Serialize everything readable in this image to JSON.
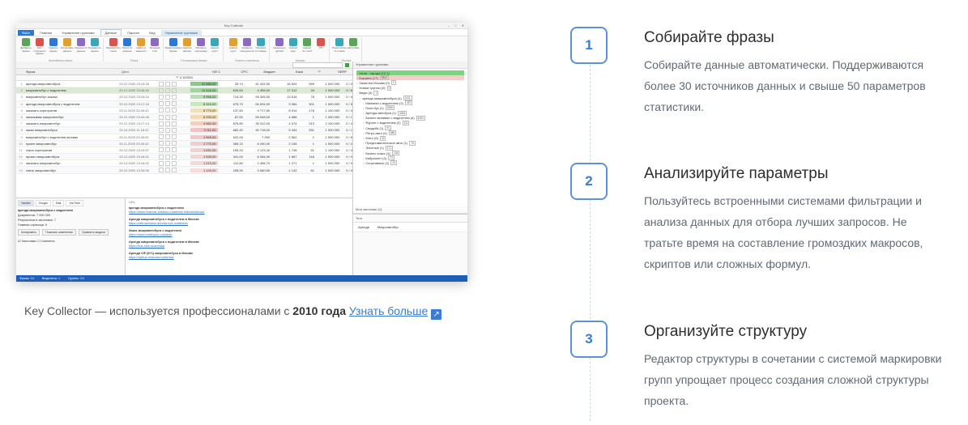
{
  "app": {
    "title": "Key Collector",
    "window_controls": [
      "–",
      "□",
      "✕"
    ],
    "ribbon_tabs": [
      "Файл",
      "Главная",
      "Управление группами",
      "Данные",
      "Парсинг",
      "Вид",
      "Управление группами"
    ],
    "ribbon_groups": [
      {
        "label": "Контейнеры фраз",
        "buttons": [
          "Добавить фразы",
          "Кол-попроекты фразы",
          "Удалить фразы",
          "Копировать данные",
          "Перенести данные",
          "Подсветить фразы"
        ]
      },
      {
        "label": "Поиск",
        "buttons": [
          "Переместить поиск",
          "Поиск по данным",
          "Найти и заменить",
          "Мощный стоп"
        ]
      },
      {
        "label": "Группировка фразы",
        "buttons": [
          "Редактировать фразы",
          "Удалить фильтр",
          "Обновить сортировку",
          "Анализ групп"
        ]
      },
      {
        "label": "Группы и фильтры",
        "buttons": [
          "Анализ групп",
          "Сравнить конкурентов",
          "Показать в словаре"
        ]
      },
      {
        "label": "Анализ",
        "buttons": [
          "Начальное дублей",
          "Анализ карт",
          "Анализ по столб",
          "КП"
        ]
      },
      {
        "label": "Прочее",
        "buttons": [
          "Пересчитать по ставке",
          "Настройки"
        ]
      }
    ],
    "grid": {
      "headers": [
        "Фраза",
        "Дата",
        "KEI 1",
        "CPC",
        "Бюджет",
        "База",
        "\"!\"",
        "SERP"
      ],
      "filter_hint": "\"!\" ≥ 110311",
      "rows": [
        {
          "n": "1",
          "phrase": "аренда микроавтобуса",
          "date": "20.12.2020 19:19:18",
          "ws": "11 580,00",
          "cpc": "33,74",
          "b1": "41 434,90",
          "b2": "18 524",
          "b3": "959",
          "b4": "1 000 000",
          "b5": "0 / 0"
        },
        {
          "n": "2",
          "phrase": "микроавтобус с водителем",
          "date": "20.12.2020 23:46:42",
          "ws": "11 416,00",
          "cpc": "629,60",
          "b1": "4 456,00",
          "b2": "17 312",
          "b3": "34",
          "b4": "1 000 000",
          "b5": "0 / 8"
        },
        {
          "n": "3",
          "phrase": "микроавтобус заказа",
          "date": "20.12.2020 23:15:10",
          "ws": "9 956,00",
          "cpc": "714,30",
          "b1": "93 305,00",
          "b2": "13 516",
          "b3": "75",
          "b4": "1 000 000",
          "b5": "0 / 0"
        },
        {
          "n": "4",
          "phrase": "аренда микроавтобуса с водителем",
          "date": "20.12.2020 13:17:15",
          "ws": "8 919,00",
          "cpc": "675,70",
          "b1": "54 534,90",
          "b2": "9 084",
          "b3": "301",
          "b4": "1 000 000",
          "b5": "0 / 5"
        },
        {
          "n": "5",
          "phrase": "заказать корпоратив",
          "date": "20.11.2020 23:40:42",
          "ws": "8 770,00",
          "cpc": "137,60",
          "b1": "9 717,80",
          "b2": "8 914",
          "b3": "178",
          "b4": "1 100 000",
          "b5": "0 / 0"
        },
        {
          "n": "6",
          "phrase": "заказываю микроавтобус",
          "date": "20.12.2020 23:44:45",
          "ws": "6 290,00",
          "cpc": "87,60",
          "b1": "59 548,00",
          "b2": "4 688",
          "b3": "1",
          "b4": "1 000 000",
          "b5": "0 / 1"
        },
        {
          "n": "7",
          "phrase": "заказать микроавтобус",
          "date": "20.12.2020 13:17:13",
          "ws": "4 962,00",
          "cpc": "875,80",
          "b1": "35 312,00",
          "b2": "4 374",
          "b3": "313",
          "b4": "2 100 000",
          "b5": "0 / 4"
        },
        {
          "n": "8",
          "phrase": "заказ микроавтобуса",
          "date": "20.10.2020 11:16:22",
          "ws": "3 111,00",
          "cpc": "682,40",
          "b1": "45 718,00",
          "b2": "5 344",
          "b3": "351",
          "b4": "1 000 000",
          "b5": "0 / 1"
        },
        {
          "n": "9",
          "phrase": "микроавтобус с водителем москва",
          "date": "20.11.2020 23:40:02",
          "ws": "1 909,00",
          "cpc": "622,00",
          "b1": "7 092",
          "b2": "2 562",
          "b3": "1",
          "b4": "1 000 000",
          "b5": "0 / 6"
        },
        {
          "n": "10",
          "phrase": "нужен микроавтобус",
          "date": "20.11.2020 23:40:42",
          "ws": "1 770,00",
          "cpc": "305,10",
          "b1": "6 290,00",
          "b2": "2 106",
          "b3": "1",
          "b4": "1 000 000",
          "b5": "0 / 2"
        },
        {
          "n": "11",
          "phrase": "такси корпоратив",
          "date": "20.12.2020 13:19:57",
          "ws": "1 691,00",
          "cpc": "195,20",
          "b1": "2 123,40",
          "b2": "1 745",
          "b3": "51",
          "b4": "1 100 000",
          "b5": "0 / 4"
        },
        {
          "n": "12",
          "phrase": "прокат микроавтобуса",
          "date": "20.12.2020 19:18:01",
          "ws": "1 545,00",
          "cpc": "341,00",
          "b1": "6 284,00",
          "b2": "1 667",
          "b3": "118",
          "b4": "1 000 000",
          "b5": "0 / 0"
        },
        {
          "n": "13",
          "phrase": "заказать микроавтобус",
          "date": "20.12.2020 13:16:22",
          "ws": "1 210,00",
          "cpc": "112,80",
          "b1": "2 456,70",
          "b2": "1 271",
          "b3": "1",
          "b4": "1 000 000",
          "b5": "0 / 0"
        },
        {
          "n": "14",
          "phrase": "снять микроавтобус",
          "date": "20.10.2020 13:16:00",
          "ws": "1 109,00",
          "cpc": "208,90",
          "b1": "3 060,90",
          "b2": "1 142",
          "b3": "61",
          "b4": "1 000 000",
          "b5": "0 / 0"
        }
      ]
    },
    "serp_panel": {
      "tabs": [
        "Yandex",
        "Google",
        "Mail",
        "YouTube"
      ],
      "query": "аренда микроавтобуса с водителем",
      "lines": [
        "Документов: 7 000 000",
        "Результатов в заголовке: 7",
        "Главная страница: 5"
      ],
      "buttons": [
        "Копировать",
        "Показать изменения",
        "Сравнить выдачи"
      ],
      "checkboxes": [
        "Заголовки",
        "Сниппеты"
      ]
    },
    "url_panel": {
      "header": "URL",
      "results": [
        {
          "title": "аренда микроавтобуса с водителем",
          "link": "https://www.moscow-autobus.ru/arenda-mikroavtobusa/"
        },
        {
          "title": "Аренда микроавтобуса с водителем в Москве",
          "link": "https://mikroavtobus-arenda.ru/s-voditelem/"
        },
        {
          "title": "Заказ микроавтобуса с водителем",
          "link": "https://www.busforyou.ru/zakaz/"
        },
        {
          "title": "Аренда микроавтобуса с водителем в Москве",
          "link": "https://bus-msk.ru/arenda/"
        },
        {
          "title": "Аренда VIP (8+1) микроавтобуса в Москве",
          "link": "https://vipbus-moscow.ru/arenda/"
        }
      ]
    },
    "groups_panel": {
      "header": "Управление группами",
      "items": [
        {
          "label": "Нали - города (10 1)",
          "tag": "",
          "style": "green"
        },
        {
          "label": "Корзина (17)",
          "tag": "9512",
          "style": "pink"
        },
        {
          "label": "Зачистка Москва (0)",
          "tag": "0",
          "style": ""
        },
        {
          "label": "Новые группы (0)",
          "tag": "0",
          "style": ""
        },
        {
          "label": "Виды (4)",
          "tag": "1",
          "style": ""
        },
        {
          "label": "аренда микроавтобуса (4)",
          "tag": "1411",
          "style": ""
        },
        {
          "label": "Минивэн с водителем (2)",
          "tag": "457",
          "style": ""
        },
        {
          "label": "Пати бус (1)",
          "tag": "2066",
          "style": ""
        },
        {
          "label": "Аренда автобуса (1)",
          "tag": "4453",
          "style": ""
        },
        {
          "label": "Бизнес минивэн с водителем (4)",
          "tag": "4053",
          "style": ""
        },
        {
          "label": "Фургон с водителем (2)",
          "tag": "111",
          "style": ""
        },
        {
          "label": "Свадьба (1)",
          "tag": "91",
          "style": ""
        },
        {
          "label": "Ретро-авто (4)",
          "tag": "686",
          "style": ""
        },
        {
          "label": "Мото (6)",
          "tag": "32",
          "style": ""
        },
        {
          "label": "Представительское авто (1)",
          "tag": "76",
          "style": ""
        },
        {
          "label": "Элитные (1)",
          "tag": "171",
          "style": ""
        },
        {
          "label": "Бизнес класс (4)",
          "tag": "134",
          "style": ""
        },
        {
          "label": "Кабриолет (4)",
          "tag": "73",
          "style": ""
        },
        {
          "label": "Спортивные (2)",
          "tag": "23",
          "style": ""
        }
      ],
      "footer": "Мои заготовки (2)"
    },
    "tags_panel": {
      "header": "Теги",
      "row_label": "Аренда",
      "row_value": "Микроавтобус"
    },
    "status_bar": [
      "Фразы: 14",
      "Выделено: 1",
      "Группы: 1/1"
    ]
  },
  "caption": {
    "prefix": "Key Collector — используется профессионалами с",
    "year": "2010 года",
    "link": "Узнать больше",
    "link_icon": "external-link-icon"
  },
  "steps": [
    {
      "number": "1",
      "title": "Собирайте фразы",
      "text": "Собирайте данные автоматически. Поддерживаются более 30 источников данных и свыше 50 параметров статистики."
    },
    {
      "number": "2",
      "title": "Анализируйте параметры",
      "text": "Пользуйтесь встроенными системами фильтрации и анализа данных для отбора лучших запросов. Не тратьте время на составление громоздких макросов, скриптов или сложных формул."
    },
    {
      "number": "3",
      "title": "Организуйте структуру",
      "text": "Редактор структуры в сочетании с системой маркировки групп упрощает процесс создания сложной структуры проекта."
    }
  ],
  "colors": {
    "accent": "#3b7bd1",
    "badge_border": "#5b93d6",
    "text_muted": "#606a76",
    "title": "#2d2d2d",
    "link": "#3a7bd5",
    "selected_row": "#dbe9d6"
  }
}
